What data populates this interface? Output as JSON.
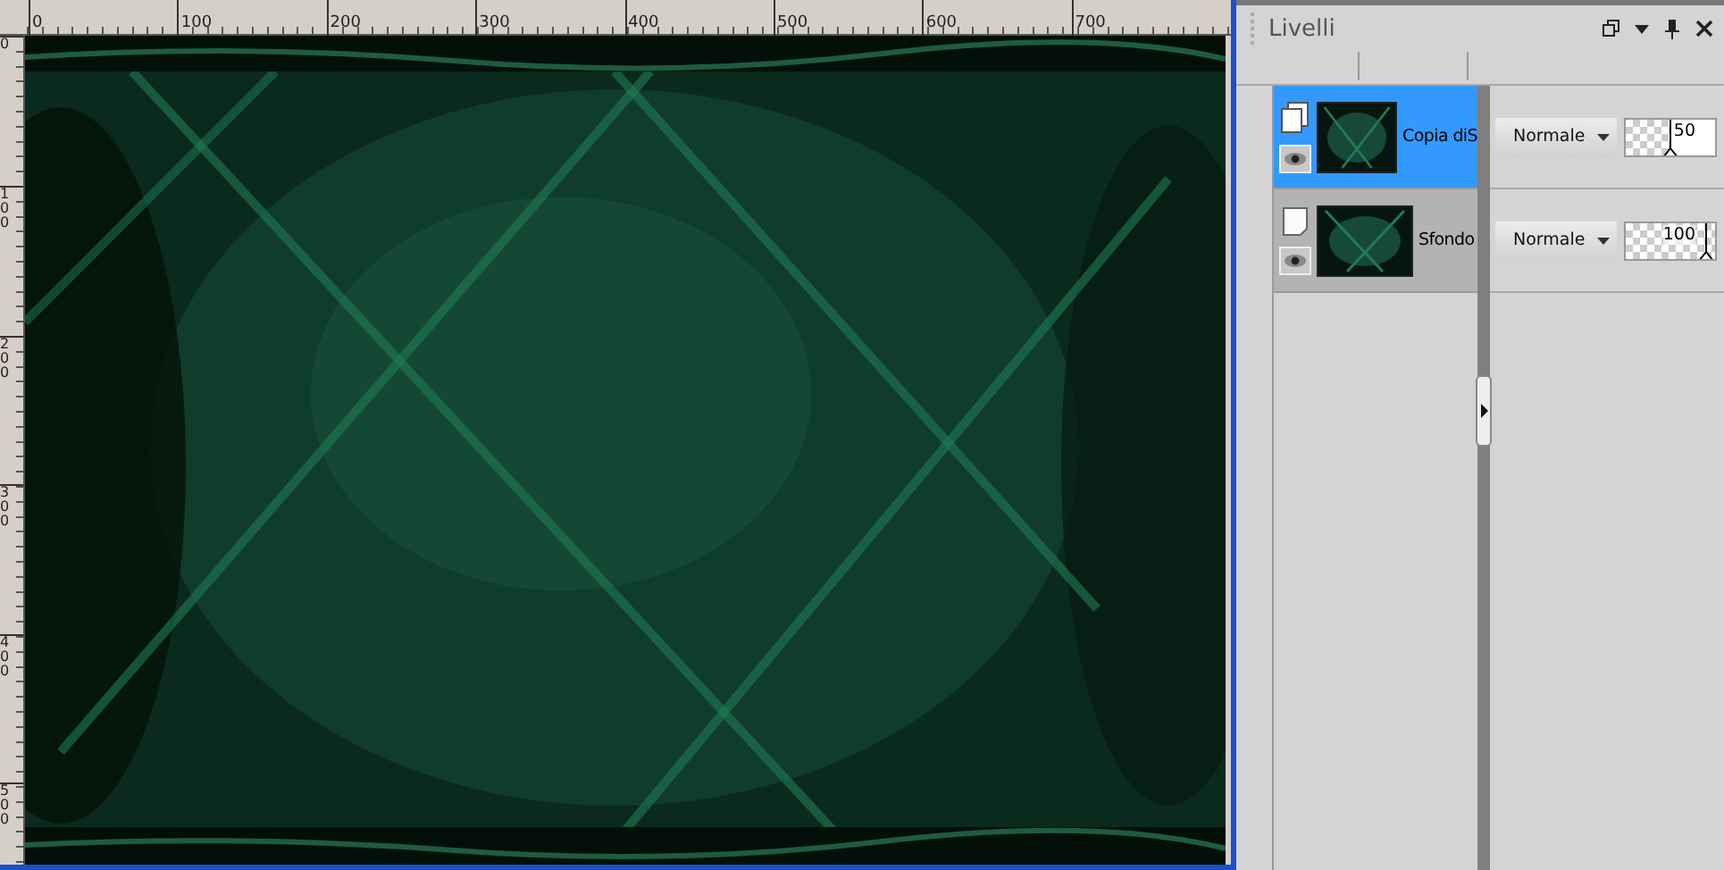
{
  "editor": {
    "top_ruler": [
      "0",
      "100",
      "200",
      "300",
      "400",
      "500",
      "600",
      "700"
    ],
    "side_ruler": [
      "0",
      "100",
      "200",
      "300",
      "400",
      "500"
    ]
  },
  "layers_panel": {
    "title": "Livelli",
    "layers": [
      {
        "kind": "raster",
        "name": "Copia diS",
        "selected": true,
        "visible": true,
        "blend_mode": "Normale",
        "opacity": "50",
        "level": 0.5
      },
      {
        "kind": "background",
        "name": "Sfondo",
        "selected": false,
        "visible": true,
        "blend_mode": "Normale",
        "opacity": "100",
        "level": 1
      }
    ]
  }
}
